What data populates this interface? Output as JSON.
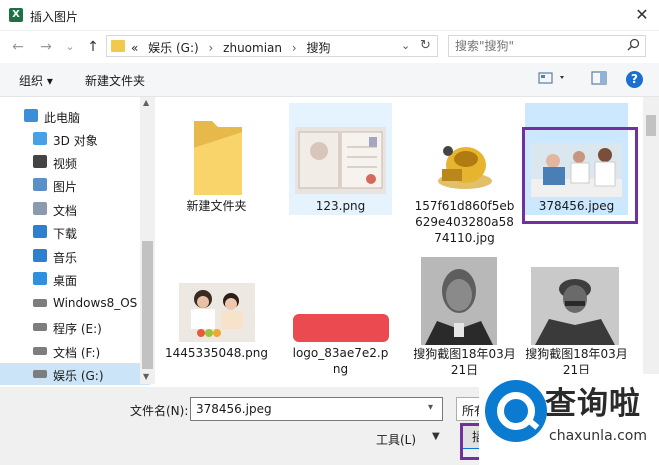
{
  "window": {
    "title": "插入图片",
    "close_glyph": "✕"
  },
  "nav": {
    "back": "←",
    "forward": "→",
    "recent": "⌄",
    "up": "↑"
  },
  "address": {
    "crumbs": [
      "«",
      "娱乐 (G:)",
      "›",
      "zhuomian",
      "›",
      "搜狗"
    ],
    "dropdown": "⌄",
    "refresh": "↻"
  },
  "search": {
    "placeholder": "搜索\"搜狗\"",
    "icon": "search-icon"
  },
  "toolbar": {
    "organize": "组织 ▾",
    "new_folder": "新建文件夹",
    "view_icon": "view-menu-icon",
    "pane_icon": "preview-pane-icon",
    "help": "?"
  },
  "sidebar": {
    "items": [
      {
        "label": "此电脑",
        "icon": "computer-icon",
        "color": "#3a8fd9"
      },
      {
        "label": "3D 对象",
        "icon": "3d-objects-icon",
        "color": "#4aa0e6"
      },
      {
        "label": "视频",
        "icon": "video-icon",
        "color": "#444444"
      },
      {
        "label": "图片",
        "icon": "pictures-icon",
        "color": "#5b8fc7"
      },
      {
        "label": "文档",
        "icon": "documents-icon",
        "color": "#8a9bb0"
      },
      {
        "label": "下载",
        "icon": "download-icon",
        "color": "#2f7fd0"
      },
      {
        "label": "音乐",
        "icon": "music-icon",
        "color": "#2f7fd0"
      },
      {
        "label": "桌面",
        "icon": "desktop-icon",
        "color": "#2f8fe0"
      },
      {
        "label": "Windows8_OS",
        "icon": "drive-icon",
        "color": "#7d7d7d"
      },
      {
        "label": "程序 (E:)",
        "icon": "drive-icon",
        "color": "#7d7d7d"
      },
      {
        "label": "文档 (F:)",
        "icon": "drive-icon",
        "color": "#7d7d7d"
      },
      {
        "label": "娱乐 (G:)",
        "icon": "drive-icon",
        "color": "#7d7d7d"
      }
    ]
  },
  "files": [
    {
      "name": "新建文件夹",
      "kind": "folder"
    },
    {
      "name": "123.png",
      "kind": "image"
    },
    {
      "name": "157f61d860f5eb629e403280a5874110.jpg",
      "kind": "image"
    },
    {
      "name": "378456.jpeg",
      "kind": "image"
    },
    {
      "name": "1445335048.png",
      "kind": "image"
    },
    {
      "name": "logo_83ae7e2.png",
      "kind": "image"
    },
    {
      "name": "搜狗截图18年03月21日",
      "kind": "image"
    },
    {
      "name": "搜狗截图18年03月21日",
      "kind": "image"
    }
  ],
  "bottom": {
    "filename_label": "文件名(N):",
    "filename_value": "378456.jpeg",
    "filetype_value": "所有",
    "tools": "工具(L)",
    "insert": "插入",
    "cancel": ""
  },
  "watermark": {
    "big": "查询啦",
    "small": "chaxunla.com",
    "color": "#0a7bd1"
  }
}
